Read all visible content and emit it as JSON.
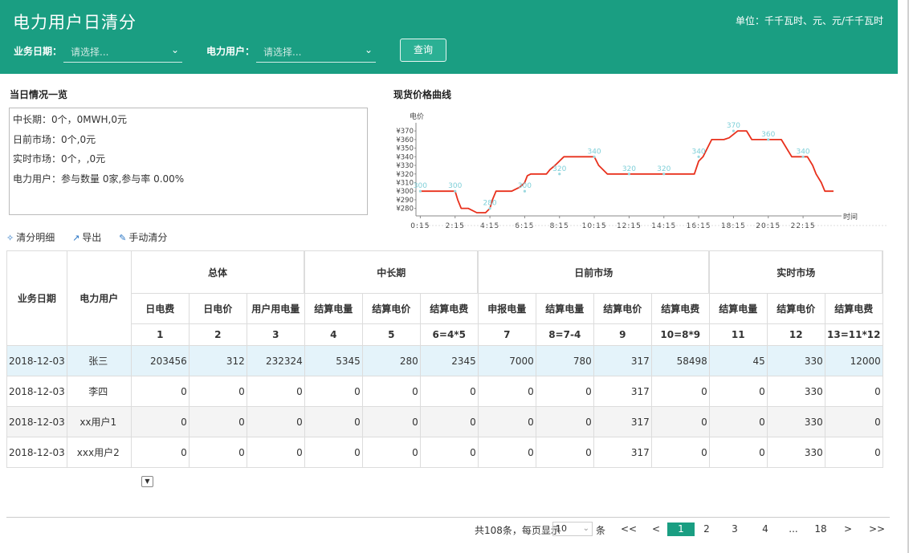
{
  "header": {
    "title": "电力用户日清分",
    "unit": "单位：千千瓦时、元、元/千千瓦时",
    "date_label": "业务日期：",
    "date_placeholder": "请选择...",
    "user_label": "电力用户：",
    "user_placeholder": "请选择...",
    "query_label": "查询"
  },
  "summary": {
    "title": "当日情况一览",
    "lines": [
      "中长期：0个，0MWH,0元",
      "日前市场：0个,0元",
      "实时市场：0个，,0元",
      "电力用户：参与数量 0家,参与率 0.00%"
    ]
  },
  "chart_title": "现货价格曲线",
  "chart_data": {
    "type": "line",
    "ylabel": "电价",
    "xlabel": "时间",
    "ylim": [
      275,
      372
    ],
    "yticks": [
      280,
      290,
      300,
      310,
      320,
      330,
      340,
      350,
      360,
      370
    ],
    "ytick_prefix": "¥",
    "xticks": [
      "0:15",
      "2:15",
      "4:15",
      "6:15",
      "8:15",
      "10:15",
      "12:15",
      "14:15",
      "16:15",
      "18:15",
      "20:15",
      "22:15"
    ],
    "series": [
      {
        "color": "#e8301c",
        "x": [
          0.25,
          1,
          2,
          2.25,
          2.4,
          2.6,
          3,
          3.5,
          4,
          4.25,
          4.4,
          4.6,
          5,
          5.5,
          6,
          6.25,
          6.4,
          6.6,
          7,
          7.5,
          7.7,
          8,
          8.5,
          9,
          9.5,
          10,
          10.25,
          10.5,
          11,
          11.5,
          12,
          12.5,
          13,
          13.5,
          14,
          14.5,
          15,
          15.5,
          16,
          16.25,
          16.5,
          16.8,
          17,
          17.5,
          17.7,
          18,
          18.5,
          19,
          19.3,
          19.6,
          20,
          20.5,
          21,
          21.3,
          21.6,
          22,
          22.5,
          22.8,
          23,
          23.3,
          23.5,
          24
        ],
        "y": [
          300,
          300,
          300,
          300,
          290,
          280,
          280,
          275,
          275,
          280,
          290,
          300,
          300,
          300,
          305,
          310,
          318,
          320,
          320,
          320,
          325,
          330,
          340,
          340,
          340,
          340,
          340,
          330,
          320,
          320,
          320,
          320,
          320,
          320,
          320,
          320,
          320,
          320,
          320,
          335,
          340,
          352,
          360,
          360,
          360,
          362,
          370,
          370,
          360,
          360,
          360,
          360,
          360,
          350,
          340,
          340,
          340,
          330,
          320,
          310,
          300,
          300
        ]
      }
    ],
    "labels": [
      {
        "x": 0.25,
        "y": 300,
        "text": "300"
      },
      {
        "x": 2.25,
        "y": 300,
        "text": "300"
      },
      {
        "x": 4.25,
        "y": 280,
        "text": "280"
      },
      {
        "x": 6.25,
        "y": 300,
        "text": "300"
      },
      {
        "x": 8.25,
        "y": 320,
        "text": "320"
      },
      {
        "x": 10.25,
        "y": 340,
        "text": "340"
      },
      {
        "x": 12.25,
        "y": 320,
        "text": "320"
      },
      {
        "x": 14.25,
        "y": 320,
        "text": "320"
      },
      {
        "x": 16.25,
        "y": 340,
        "text": "340"
      },
      {
        "x": 18.25,
        "y": 370,
        "text": "370"
      },
      {
        "x": 20.25,
        "y": 360,
        "text": "360"
      },
      {
        "x": 22.25,
        "y": 340,
        "text": "340"
      }
    ]
  },
  "toolbar": {
    "detail": "清分明细",
    "export": "导出",
    "manual": "手动清分"
  },
  "table": {
    "col_date": "业务日期",
    "col_user": "电力用户",
    "groups": [
      "总体",
      "中长期",
      "日前市场",
      "实时市场"
    ],
    "subheaders": [
      "日电费",
      "日电价",
      "用户用电量",
      "结算电量",
      "结算电价",
      "结算电费",
      "申报电量",
      "结算电量",
      "结算电价",
      "结算电费",
      "结算电量",
      "结算电价",
      "结算电费"
    ],
    "numbers": [
      "1",
      "2",
      "3",
      "4",
      "5",
      "6=4*5",
      "7",
      "8=7-4",
      "9",
      "10=8*9",
      "11",
      "12",
      "13=11*12"
    ],
    "rows": [
      {
        "date": "2018-12-03",
        "user": "张三",
        "vals": [
          "203456",
          "312",
          "232324",
          "5345",
          "280",
          "2345",
          "7000",
          "780",
          "317",
          "58498",
          "45",
          "330",
          "12000"
        ]
      },
      {
        "date": "2018-12-03",
        "user": "李四",
        "vals": [
          "0",
          "0",
          "0",
          "0",
          "0",
          "0",
          "0",
          "0",
          "317",
          "0",
          "0",
          "330",
          "0"
        ]
      },
      {
        "date": "2018-12-03",
        "user": "xx用户1",
        "vals": [
          "0",
          "0",
          "0",
          "0",
          "0",
          "0",
          "0",
          "0",
          "317",
          "0",
          "0",
          "330",
          "0"
        ]
      },
      {
        "date": "2018-12-03",
        "user": "xxx用户2",
        "vals": [
          "0",
          "0",
          "0",
          "0",
          "0",
          "0",
          "0",
          "0",
          "317",
          "0",
          "0",
          "330",
          "0"
        ]
      }
    ]
  },
  "pagination": {
    "total_prefix": "共108条，每页显示",
    "page_size": "10",
    "unit": "条",
    "first": "<<",
    "prev": "<",
    "pages": [
      "1",
      "2",
      "3",
      "4",
      "...",
      "18"
    ],
    "next": ">",
    "last": ">>"
  },
  "colors": {
    "header": "#1a9e82",
    "line": "#e8301c",
    "label": "#7ecfd8",
    "selected_row": "#e4f3fa"
  }
}
